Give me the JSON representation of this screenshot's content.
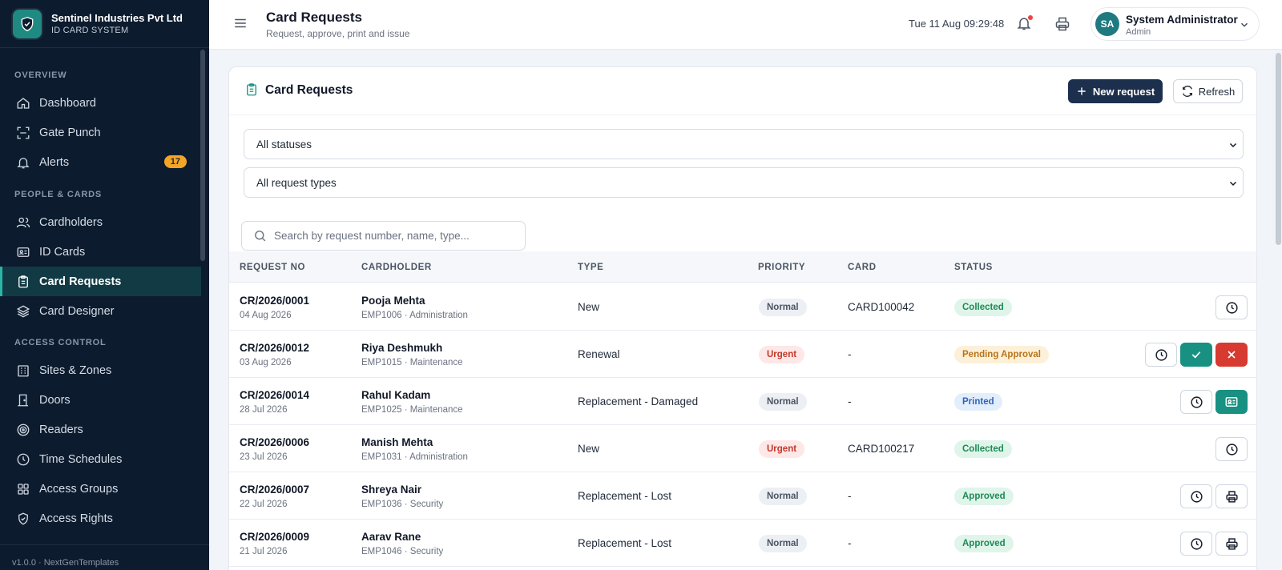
{
  "sidebar": {
    "brand_name": "Sentinel Industries Pvt Ltd",
    "brand_sub": "ID CARD SYSTEM",
    "sections": [
      "OVERVIEW",
      "PEOPLE & CARDS",
      "ACCESS CONTROL"
    ],
    "items": [
      {
        "label": "Dashboard",
        "icon": "home-icon"
      },
      {
        "label": "Gate Punch",
        "icon": "scan-icon"
      },
      {
        "label": "Alerts",
        "icon": "bell-icon",
        "badge": "17"
      },
      {
        "label": "Cardholders",
        "icon": "users-icon"
      },
      {
        "label": "ID Cards",
        "icon": "id-card-icon"
      },
      {
        "label": "Card Requests",
        "icon": "clipboard-icon",
        "active": true
      },
      {
        "label": "Card Designer",
        "icon": "layers-icon"
      },
      {
        "label": "Sites & Zones",
        "icon": "building-icon"
      },
      {
        "label": "Doors",
        "icon": "door-icon"
      },
      {
        "label": "Readers",
        "icon": "target-icon"
      },
      {
        "label": "Time Schedules",
        "icon": "clock-icon"
      },
      {
        "label": "Access Groups",
        "icon": "grid-icon"
      },
      {
        "label": "Access Rights",
        "icon": "shield-check-icon"
      }
    ],
    "footer": "v1.0.0 · NextGenTemplates"
  },
  "header": {
    "title": "Card Requests",
    "subtitle": "Request, approve, print and issue",
    "datetime": "Tue 11 Aug 09:29:48",
    "user_initials": "SA",
    "user_name": "System Administrator",
    "user_role": "Admin"
  },
  "panel": {
    "title": "Card Requests",
    "new_label": "New request",
    "refresh_label": "Refresh",
    "status_filter": "All statuses",
    "type_filter": "All request types",
    "search_placeholder": "Search by request number, name, type..."
  },
  "table": {
    "columns": [
      "REQUEST NO",
      "CARDHOLDER",
      "TYPE",
      "PRIORITY",
      "CARD",
      "STATUS"
    ],
    "rows": [
      {
        "req": "CR/2026/0001",
        "date": "04 Aug 2026",
        "name": "Pooja Mehta",
        "emp": "EMP1006 · Administration",
        "type": "New",
        "priority": "Normal",
        "card": "CARD100042",
        "status": "Collected",
        "actions": [
          "history"
        ]
      },
      {
        "req": "CR/2026/0012",
        "date": "03 Aug 2026",
        "name": "Riya Deshmukh",
        "emp": "EMP1015 · Maintenance",
        "type": "Renewal",
        "priority": "Urgent",
        "card": "-",
        "status": "Pending Approval",
        "actions": [
          "history",
          "approve",
          "reject"
        ]
      },
      {
        "req": "CR/2026/0014",
        "date": "28 Jul 2026",
        "name": "Rahul Kadam",
        "emp": "EMP1025 · Maintenance",
        "type": "Replacement - Damaged",
        "priority": "Normal",
        "card": "-",
        "status": "Printed",
        "actions": [
          "history",
          "issue"
        ]
      },
      {
        "req": "CR/2026/0006",
        "date": "23 Jul 2026",
        "name": "Manish Mehta",
        "emp": "EMP1031 · Administration",
        "type": "New",
        "priority": "Urgent",
        "card": "CARD100217",
        "status": "Collected",
        "actions": [
          "history"
        ]
      },
      {
        "req": "CR/2026/0007",
        "date": "22 Jul 2026",
        "name": "Shreya Nair",
        "emp": "EMP1036 · Security",
        "type": "Replacement - Lost",
        "priority": "Normal",
        "card": "-",
        "status": "Approved",
        "actions": [
          "history",
          "print"
        ]
      },
      {
        "req": "CR/2026/0009",
        "date": "21 Jul 2026",
        "name": "Aarav Rane",
        "emp": "EMP1046 · Security",
        "type": "Replacement - Lost",
        "priority": "Normal",
        "card": "-",
        "status": "Approved",
        "actions": [
          "history",
          "print"
        ]
      }
    ]
  }
}
